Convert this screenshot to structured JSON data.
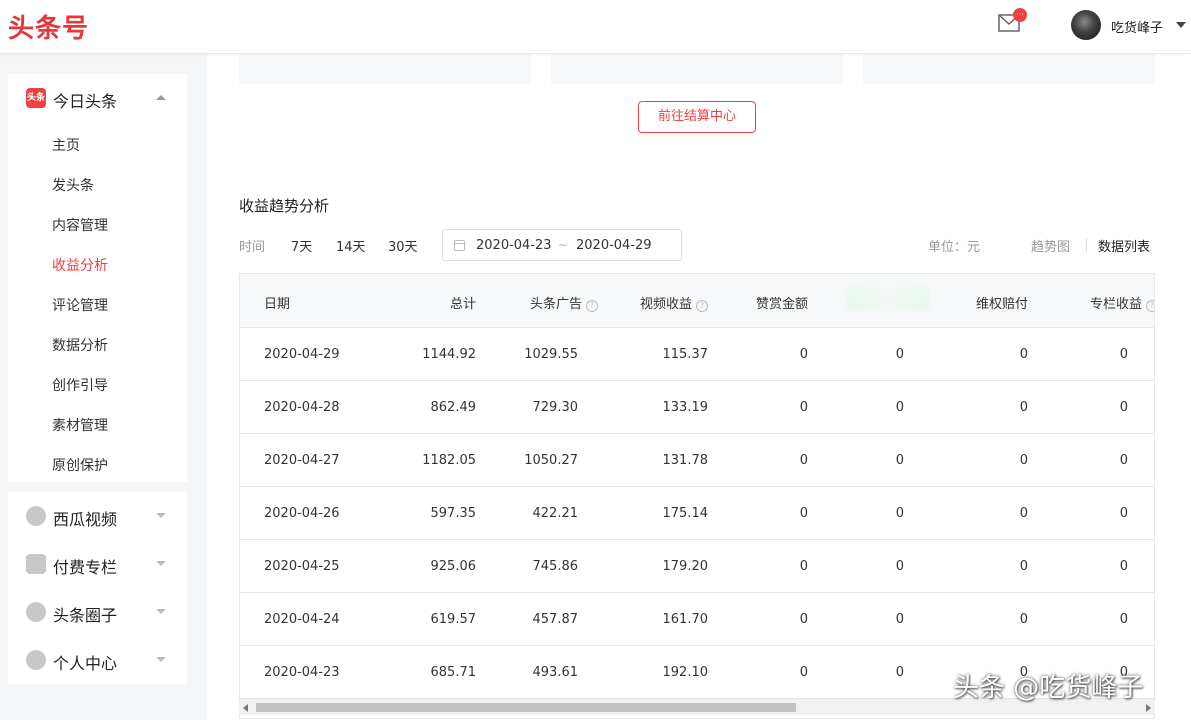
{
  "header": {
    "logo": "头条号",
    "mail_badge": "···",
    "user_name": "吃货峰子"
  },
  "sidebar": {
    "main_group": {
      "label": "今日头条",
      "icon_text": "头条",
      "items": [
        "主页",
        "发头条",
        "内容管理",
        "收益分析",
        "评论管理",
        "数据分析",
        "创作引导",
        "素材管理",
        "原创保护"
      ],
      "active_index": 3
    },
    "groups": [
      {
        "label": "西瓜视频",
        "icon": "play-circle-icon"
      },
      {
        "label": "付费专栏",
        "icon": "document-icon"
      },
      {
        "label": "头条圈子",
        "icon": "circle-icon"
      },
      {
        "label": "个人中心",
        "icon": "person-icon"
      }
    ]
  },
  "main": {
    "settle_button": "前往结算中心",
    "section_title": "收益趋势分析",
    "time_label": "时间",
    "ranges": [
      "7天",
      "14天",
      "30天"
    ],
    "date_start": "2020-04-23",
    "date_sep": "~",
    "date_end": "2020-04-29",
    "unit": "单位：元",
    "view_trend": "趋势图",
    "view_list": "数据列表"
  },
  "table": {
    "columns": [
      "日期",
      "总计",
      "头条广告",
      "视频收益",
      "赞赏金额",
      "",
      "维权赔付",
      "专栏收益"
    ],
    "help_columns": [
      2,
      3,
      7
    ],
    "rows": [
      [
        "2020-04-29",
        "1144.92",
        "1029.55",
        "115.37",
        "0",
        "0",
        "0",
        "0"
      ],
      [
        "2020-04-28",
        "862.49",
        "729.30",
        "133.19",
        "0",
        "0",
        "0",
        "0"
      ],
      [
        "2020-04-27",
        "1182.05",
        "1050.27",
        "131.78",
        "0",
        "0",
        "0",
        "0"
      ],
      [
        "2020-04-26",
        "597.35",
        "422.21",
        "175.14",
        "0",
        "0",
        "0",
        "0"
      ],
      [
        "2020-04-25",
        "925.06",
        "745.86",
        "179.20",
        "0",
        "0",
        "0",
        "0"
      ],
      [
        "2020-04-24",
        "619.57",
        "457.87",
        "161.70",
        "0",
        "0",
        "0",
        "0"
      ],
      [
        "2020-04-23",
        "685.71",
        "493.61",
        "192.10",
        "0",
        "0",
        "0",
        "0"
      ]
    ]
  },
  "watermark": "头条 @吃货峰子",
  "colors": {
    "brand": "#e8353b",
    "accent": "#f04142"
  }
}
